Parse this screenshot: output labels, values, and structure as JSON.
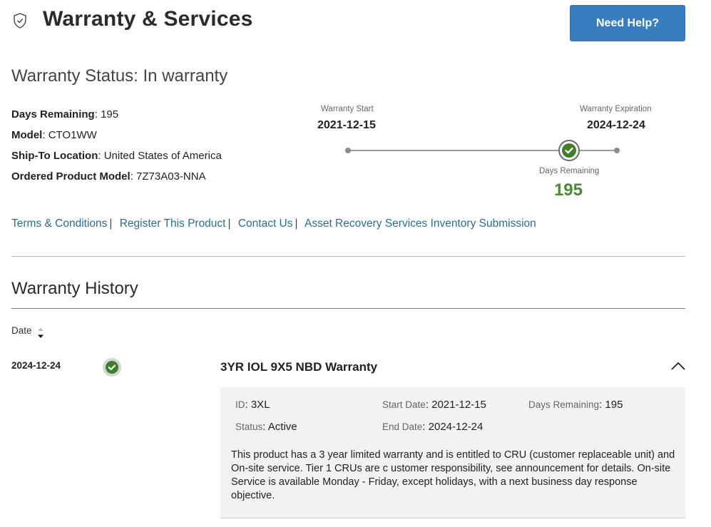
{
  "header": {
    "title": "Warranty & Services",
    "help_button": "Need Help?",
    "icon": "shield-check-icon"
  },
  "status": {
    "label": "Warranty Status:",
    "value": "In warranty"
  },
  "details": [
    {
      "key": "Days Remaining",
      "value": "195"
    },
    {
      "key": "Model",
      "value": "CTO1WW"
    },
    {
      "key": "Ship-To Location",
      "value": "United States of America"
    },
    {
      "key": "Ordered Product Model",
      "value": "7Z73A03-NNA"
    }
  ],
  "timeline": {
    "start_label": "Warranty Start",
    "start_date": "2021-12-15",
    "end_label": "Warranty Expiration",
    "end_date": "2024-12-24",
    "remaining_label": "Days Remaining",
    "remaining_value": "195",
    "elapsed_fraction": 0.82,
    "accent": "#4a8a32"
  },
  "links": [
    "Terms & Conditions",
    "Register This Product",
    "Contact Us",
    "Asset Recovery Services Inventory Submission"
  ],
  "history": {
    "title": "Warranty History",
    "date_column": "Date",
    "rows": [
      {
        "date": "2024-12-24",
        "name": "3YR IOL 9X5 NBD Warranty",
        "id_label": "ID",
        "id": "3XL",
        "status_label": "Status",
        "status": "Active",
        "start_label": "Start Date",
        "start": "2021-12-15",
        "end_label": "End Date",
        "end": "2024-12-24",
        "days_label": "Days Remaining",
        "days": "195",
        "description": "This product has a 3 year limited warranty and is entitled to CRU (customer replaceable unit) and On-site service. Tier 1 CRUs are c ustomer responsibility, see announcement for details. On-site Service is available Monday - Friday, except holidays, with a next business day response objective."
      }
    ]
  },
  "colors": {
    "link": "#2a6e8d",
    "button": "#3a7dbf",
    "success": "#3e7e2c"
  }
}
